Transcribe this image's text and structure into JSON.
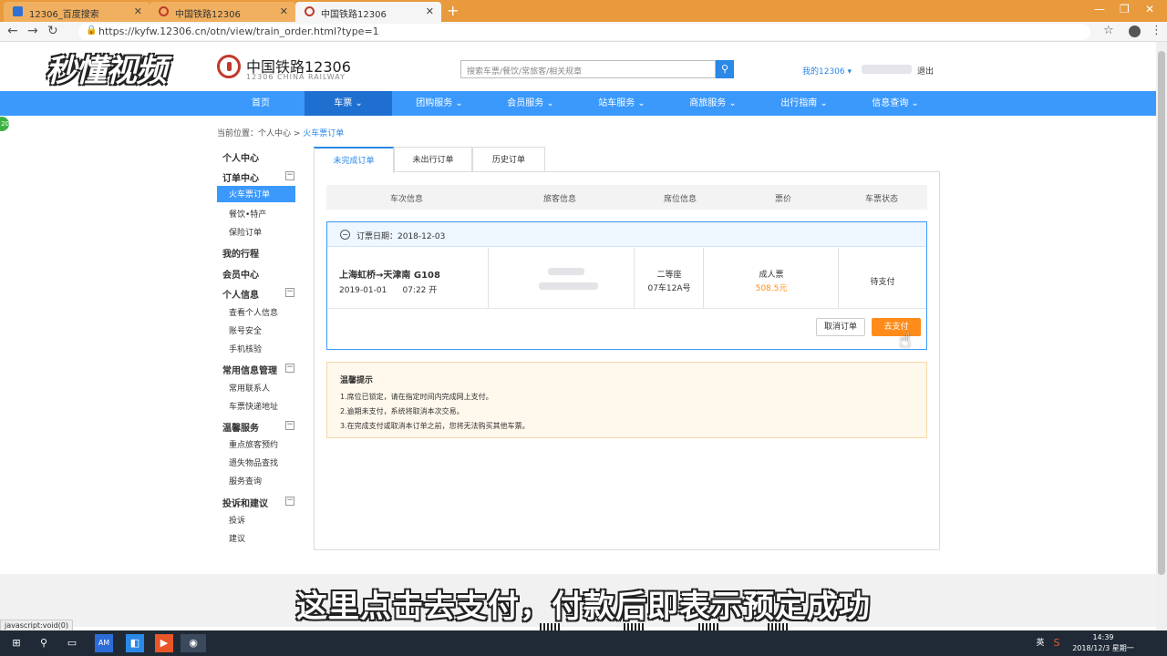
{
  "browser": {
    "tabs": [
      {
        "title": "12306_百度搜索"
      },
      {
        "title": "中国铁路12306"
      },
      {
        "title": "中国铁路12306"
      }
    ],
    "url": "https://kyfw.12306.cn/otn/view/train_order.html?type=1",
    "status_url": "javascript:void(0)"
  },
  "watermark": "秒懂视频",
  "header": {
    "logo_title": "中国铁路12306",
    "logo_sub": "12306 CHINA RAILWAY",
    "search_placeholder": "搜索车票/餐饮/常旅客/相关规章",
    "my12306": "我的12306",
    "logout": "退出"
  },
  "nav": [
    "首页",
    "车票",
    "团购服务",
    "会员服务",
    "站车服务",
    "商旅服务",
    "出行指南",
    "信息查询"
  ],
  "breadcrumb": {
    "prefix": "当前位置：个人中心 > ",
    "current": "火车票订单"
  },
  "sidebar": {
    "personal_center": "个人中心",
    "order_center": "订单中心",
    "train_orders": "火车票订单",
    "food": "餐饮•特产",
    "insurance": "保险订单",
    "my_trips": "我的行程",
    "member_center": "会员中心",
    "personal_info": "个人信息",
    "view_info": "查看个人信息",
    "account_security": "账号安全",
    "phone_verify": "手机核验",
    "common_info": "常用信息管理",
    "contacts": "常用联系人",
    "delivery_address": "车票快递地址",
    "warm_service": "温馨服务",
    "priority_booking": "重点旅客预约",
    "lost_found": "遗失物品查找",
    "service_query": "服务查询",
    "complaints": "投诉和建议",
    "complaint": "投诉",
    "suggestion": "建议"
  },
  "order_tabs": [
    "未完成订单",
    "未出行订单",
    "历史订单"
  ],
  "table_headers": [
    "车次信息",
    "旅客信息",
    "席位信息",
    "票价",
    "车票状态"
  ],
  "order": {
    "date_label": "订票日期：2018-12-03",
    "route": "上海虹桥→天津南 G108",
    "departure": "2019-01-01      07:22 开",
    "seat_class": "二等座",
    "seat_no": "07车12A号",
    "ticket_type": "成人票",
    "price": "508.5元",
    "status": "待支付",
    "cancel_label": "取消订单",
    "pay_label": "去支付"
  },
  "tips": {
    "title": "温馨提示",
    "items": [
      "1.席位已锁定，请在指定时间内完成网上支付。",
      "2.逾期未支付，系统将取消本次交易。",
      "3.在完成支付或取消本订单之前，您将无法购买其他车票。"
    ]
  },
  "subtitle": "这里点击去支付，付款后即表示预定成功",
  "taskbar": {
    "time": "14:39",
    "date": "2018/12/3 星期一",
    "lang": "英"
  },
  "colors": {
    "nav_blue": "#3b99fc",
    "pay_orange": "#ff8c1a",
    "browser_orange": "#e89a3c"
  }
}
